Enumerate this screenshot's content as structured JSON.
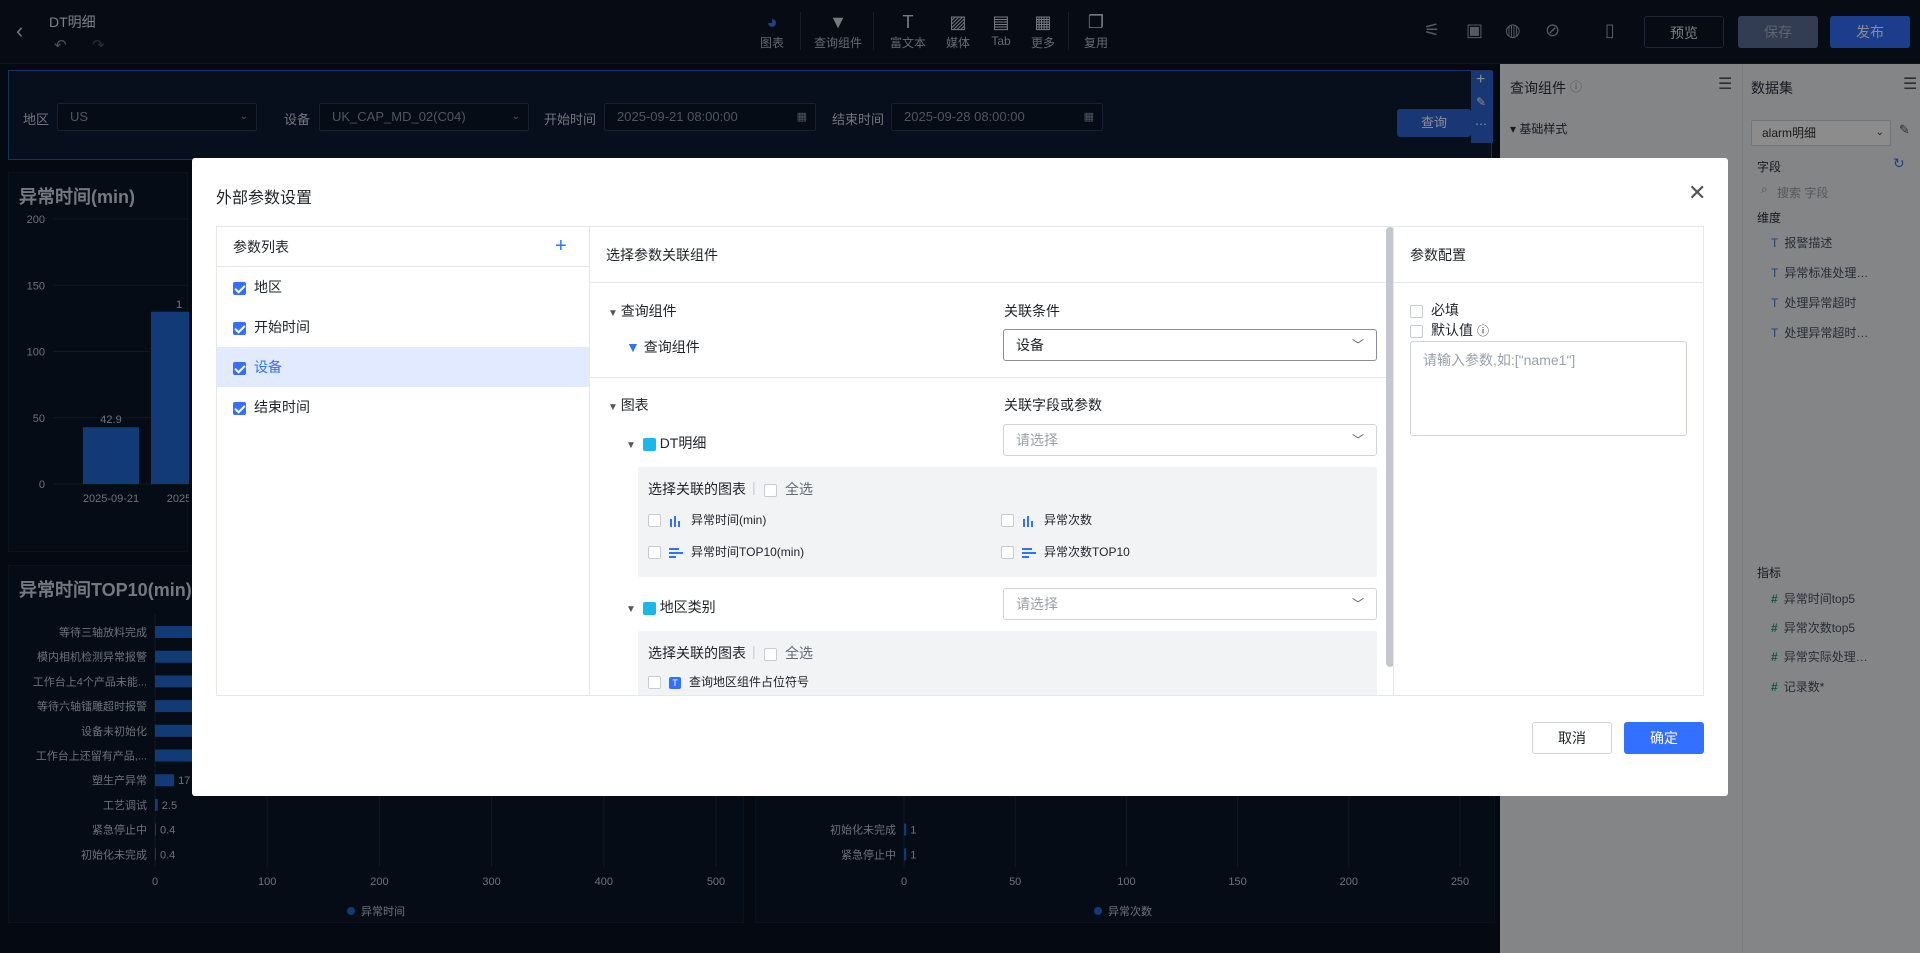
{
  "app": {
    "title": "DT明细"
  },
  "toolbar": {
    "items": [
      {
        "label": "图表",
        "icon": "pie-chart-icon"
      },
      {
        "label": "查询组件",
        "icon": "filter-icon"
      },
      {
        "label": "富文本",
        "icon": "text-icon"
      },
      {
        "label": "媒体",
        "icon": "image-icon"
      },
      {
        "label": "Tab",
        "icon": "tab-icon"
      },
      {
        "label": "更多",
        "icon": "grid-icon"
      },
      {
        "label": "复用",
        "icon": "copy-icon"
      }
    ],
    "preview_label": "预览",
    "save_label": "保存",
    "publish_label": "发布",
    "accent": "#3370ff"
  },
  "filterbar": {
    "region_label": "地区",
    "region_value": "US",
    "device_label": "设备",
    "device_value": "UK_CAP_MD_02(C04)",
    "start_label": "开始时间",
    "start_value": "2025-09-21 08:00:00",
    "end_label": "结束时间",
    "end_value": "2025-09-28 08:00:00",
    "query_label": "查询"
  },
  "charts": {
    "abnormal_time_title": "异常时间(min)",
    "top10_title": "异常时间TOP10(min)",
    "legend_time": "异常时间",
    "legend_count": "异常次数"
  },
  "chart_data": [
    {
      "type": "bar",
      "title": "异常时间(min)",
      "categories": [
        "2025-09-21",
        "2025"
      ],
      "values": [
        42.9,
        130
      ],
      "value_labels": [
        "42.9",
        "1"
      ],
      "ylim": [
        0,
        200
      ],
      "yticks": [
        "0",
        "50",
        "100",
        "150",
        "200"
      ]
    },
    {
      "type": "bar",
      "orientation": "horizontal",
      "title": "异常时间TOP10(min)",
      "categories": [
        "等待三轴放料完成",
        "模内相机检测异常报警",
        "工作台上4个产品未能...",
        "等待六轴镭雕超时报警",
        "设备未初始化",
        "工作台上还留有产品,...",
        "塑生产异常",
        "工艺调试",
        "紧急停止中",
        "初始化未完成"
      ],
      "values": [
        500,
        500,
        500,
        500,
        500,
        500,
        17,
        2.5,
        0.4,
        0.4
      ],
      "value_labels": [
        "",
        "",
        "",
        "",
        "",
        "",
        "17",
        "2.5",
        "0.4",
        "0.4"
      ],
      "xlim": [
        0,
        500
      ],
      "xticks": [
        "0",
        "100",
        "200",
        "300",
        "400",
        "500"
      ],
      "series": [
        {
          "name": "异常时间"
        }
      ]
    },
    {
      "type": "bar",
      "orientation": "horizontal",
      "categories": [
        "初始化未完成",
        "紧急停止中"
      ],
      "values": [
        1,
        1
      ],
      "value_labels": [
        "1",
        "1"
      ],
      "xlim": [
        0,
        250
      ],
      "xticks": [
        "0",
        "50",
        "100",
        "150",
        "200",
        "250"
      ],
      "series": [
        {
          "name": "异常次数"
        }
      ]
    }
  ],
  "right_panel": {
    "title": "查询组件",
    "section": "基础样式"
  },
  "dataset": {
    "title": "数据集",
    "selected": "alarm明细",
    "fields_label": "字段",
    "search_placeholder": "搜索 字段",
    "dimension_label": "维度",
    "dimensions": [
      "报警描述",
      "异常标准处理…",
      "处理异常超时",
      "处理异常超时…"
    ],
    "metric_label": "指标",
    "metrics": [
      "异常时间top5",
      "异常次数top5",
      "异常实际处理…",
      "记录数*"
    ]
  },
  "modal": {
    "title": "外部参数设置",
    "param_list_title": "参数列表",
    "params": [
      {
        "label": "地区",
        "checked": true,
        "active": false
      },
      {
        "label": "开始时间",
        "checked": true,
        "active": false
      },
      {
        "label": "设备",
        "checked": true,
        "active": true
      },
      {
        "label": "结束时间",
        "checked": true,
        "active": false
      }
    ],
    "middle_title": "选择参数关联组件",
    "query_group": "查询组件",
    "condition_label": "关联条件",
    "query_item": "查询组件",
    "condition_value": "设备",
    "chart_group": "图表",
    "field_or_param_label": "关联字段或参数",
    "dt_group": "DT明细",
    "select_placeholder": "请选择",
    "select_chart_label": "选择关联的图表",
    "select_all": "全选",
    "dt_charts": [
      "异常时间(min)",
      "异常次数",
      "异常时间TOP10(min)",
      "异常次数TOP10"
    ],
    "region_group": "地区类别",
    "region_charts": [
      "查询地区组件占位符号"
    ],
    "config_title": "参数配置",
    "required_label": "必填",
    "default_label": "默认值",
    "default_placeholder": "请输入参数,如:[\"name1\"]",
    "cancel_label": "取消",
    "confirm_label": "确定"
  }
}
